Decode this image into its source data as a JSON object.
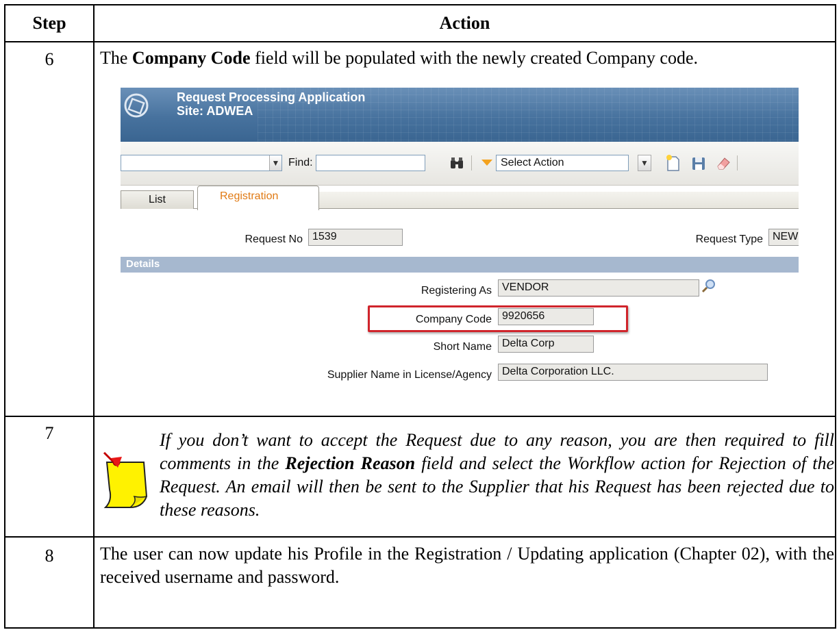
{
  "table": {
    "headers": {
      "step": "Step",
      "action": "Action"
    },
    "rows": [
      {
        "step": "6",
        "text_before": "The ",
        "text_bold": "Company Code",
        "text_after": " field will be populated with the newly created Company code."
      },
      {
        "step": "7",
        "note_part1": "If you don’t want to accept the Request due to any reason, you are then required to fill comments in the ",
        "note_bold": "Rejection Reason",
        "note_part2": " field and select the Workflow action for Rejection of the Request. An email will then be sent to the Supplier that his Request has been rejected due to these reasons."
      },
      {
        "step": "8",
        "text": "The user can now update his Profile in the Registration / Updating application (Chapter 02), with the received username and password."
      }
    ]
  },
  "screenshot": {
    "app_title": "Request Processing Application",
    "site": "Site: ADWEA",
    "toolbar": {
      "find_label": "Find:",
      "find_value": "",
      "select_action": "Select Action",
      "colors": {
        "arrow": "#f4a21d"
      }
    },
    "tabs": [
      {
        "label": "List",
        "active": false
      },
      {
        "label": "Registration",
        "active": true
      }
    ],
    "header_fields": {
      "request_no_label": "Request No",
      "request_no_value": "1539",
      "request_type_label": "Request Type",
      "request_type_value": "NEW"
    },
    "details": {
      "section_label": "Details",
      "registering_as_label": "Registering As",
      "registering_as_value": "VENDOR",
      "company_code_label": "Company Code",
      "company_code_value": "9920656",
      "short_name_label": "Short Name",
      "short_name_value": "Delta Corp",
      "supplier_name_label": "Supplier Name in License/Agency",
      "supplier_name_value": "Delta Corporation LLC."
    },
    "highlight_color": "#d0242b"
  }
}
